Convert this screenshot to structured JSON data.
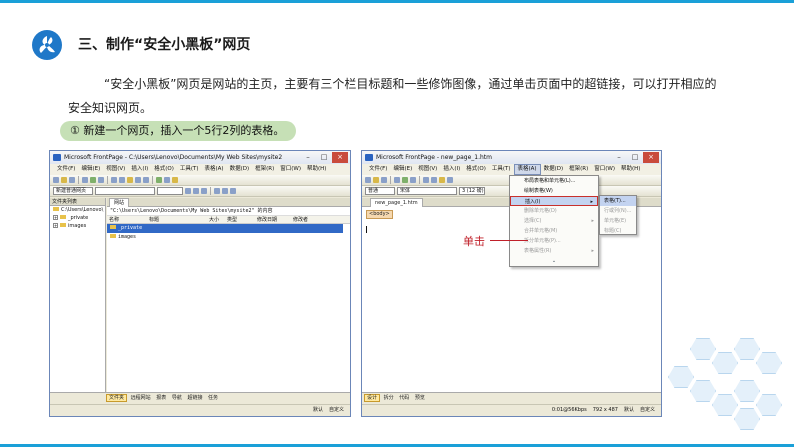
{
  "slide": {
    "title": "三、制作“安全小黑板”网页",
    "paragraph": "“安全小黑板”网页是网站的主页，主要有三个栏目标题和一些修饰图像，通过单击页面中的超链接，可以打开相应的安全知识网页。",
    "step": "① 新建一个网页，插入一个5行2列的表格。",
    "callout": "单击",
    "accent_color": "#1aa0d8"
  },
  "window_a": {
    "title": "Microsoft FrontPage - C:\\Users\\Lenovo\\Documents\\My Web Sites\\mysite2",
    "menu": [
      "文件(F)",
      "编辑(E)",
      "视图(V)",
      "插入(I)",
      "格式(O)",
      "工具(T)",
      "表格(A)",
      "数据(D)",
      "框架(R)",
      "窗口(W)",
      "帮助(H)"
    ],
    "combo": "新建普通网页",
    "folder_list": {
      "header": "文件夹列表",
      "root": "C:\\Users\\Lenovo\\",
      "items": [
        "_private",
        "images"
      ]
    },
    "tab": "网站",
    "path": "\"C:\\Users\\Lenovo\\Documents\\My Web Sites\\mysite2\" 的内容",
    "columns": [
      "名称",
      "标题",
      "大小",
      "类型",
      "修改日期",
      "修改者"
    ],
    "files": [
      "_private",
      "images"
    ],
    "view_tabs": [
      "文件夹",
      "远程网站",
      "报表",
      "导航",
      "超链接",
      "任务"
    ],
    "status": [
      "默认",
      "自定义"
    ]
  },
  "window_b": {
    "title": "Microsoft FrontPage - new_page_1.htm",
    "menu": [
      "文件(F)",
      "编辑(E)",
      "视图(V)",
      "插入(I)",
      "格式(O)",
      "工具(T)",
      "表格(A)",
      "数据(D)",
      "框架(R)",
      "窗口(W)",
      "帮助(H)"
    ],
    "style_combo": "普通",
    "font_combo": "宋体",
    "size_combo": "3 (12 磅)",
    "doc_tab": "new_page_1.htm",
    "body_tag": "<body>",
    "table_menu": [
      {
        "label": "布局表格和单元格(L)...",
        "disabled": false
      },
      {
        "label": "绘制表格(W)",
        "disabled": false
      },
      {
        "label": "插入(I)",
        "disabled": false,
        "highlight": true,
        "submenu": true
      },
      {
        "label": "删除单元格(D)",
        "disabled": true
      },
      {
        "label": "选择(C)",
        "disabled": true,
        "submenu": true
      },
      {
        "label": "合并单元格(M)",
        "disabled": true
      },
      {
        "label": "拆分单元格(P)...",
        "disabled": true
      },
      {
        "label": "表格属性(R)",
        "disabled": true,
        "submenu": true
      }
    ],
    "insert_submenu": [
      "表格(T)...",
      "行或列(N)...",
      "单元格(E)",
      "标题(C)"
    ],
    "view_tabs": [
      "设计",
      "拆分",
      "代码",
      "预览"
    ],
    "status": [
      "0:01@56Kbps",
      "792 x 487",
      "默认",
      "自定义"
    ]
  }
}
